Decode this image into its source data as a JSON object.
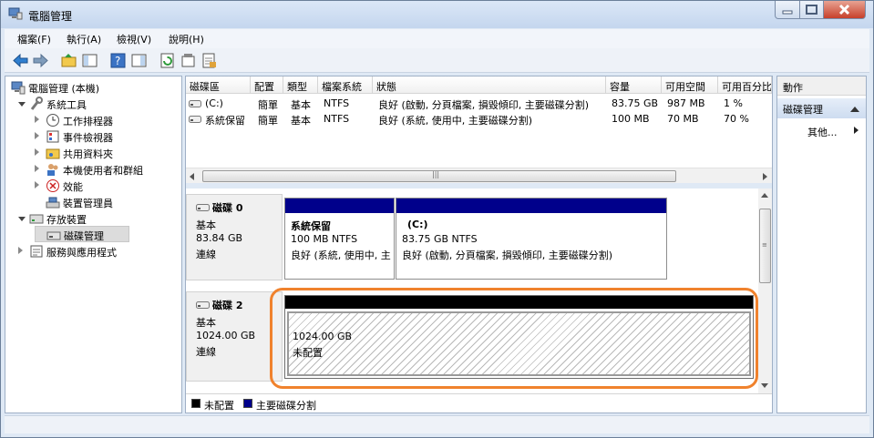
{
  "window": {
    "title": "電腦管理"
  },
  "menu": [
    "檔案(F)",
    "執行(A)",
    "檢視(V)",
    "說明(H)"
  ],
  "toolbar": {
    "icons": [
      "back-arrow-icon",
      "forward-arrow-icon",
      "up-folder-icon",
      "show-hide-tree-icon",
      "help-icon",
      "properties-view-icon",
      "refresh-icon",
      "properties-icon",
      "export-icon"
    ]
  },
  "tree": [
    {
      "label": "電腦管理 (本機)",
      "level": 0
    },
    {
      "label": "系統工具",
      "level": 1,
      "expanded": true
    },
    {
      "label": "工作排程器",
      "level": 2
    },
    {
      "label": "事件檢視器",
      "level": 2
    },
    {
      "label": "共用資料夾",
      "level": 2
    },
    {
      "label": "本機使用者和群組",
      "level": 2
    },
    {
      "label": "效能",
      "level": 2
    },
    {
      "label": "裝置管理員",
      "level": 2
    },
    {
      "label": "存放裝置",
      "level": 1,
      "expanded": true
    },
    {
      "label": "磁碟管理",
      "level": 2,
      "selected": true
    },
    {
      "label": "服務與應用程式",
      "level": 1
    }
  ],
  "volume_list": {
    "headers": [
      "磁碟區",
      "配置",
      "類型",
      "檔案系統",
      "狀態",
      "容量",
      "可用空間",
      "可用百分比"
    ],
    "rows": [
      [
        "(C:)",
        "簡單",
        "基本",
        "NTFS",
        "良好 (啟動, 分頁檔案, 損毀傾印, 主要磁碟分割)",
        "83.75 GB",
        "987 MB",
        "1 %"
      ],
      [
        "系統保留",
        "簡單",
        "基本",
        "NTFS",
        "良好 (系統, 使用中, 主要磁碟分割)",
        "100 MB",
        "70 MB",
        "70 %"
      ]
    ]
  },
  "disks": [
    {
      "name": "磁碟 0",
      "type": "基本",
      "size": "83.84 GB",
      "status": "連線",
      "partitions": [
        {
          "name": "系統保留",
          "size_fs": "100 MB NTFS",
          "status": "良好 (系統, 使用中, 主要磁碟分割)"
        },
        {
          "name": "(C:)",
          "size_fs": "83.75 GB NTFS",
          "status": "良好 (啟動, 分頁檔案, 損毀傾印, 主要磁碟分割)"
        }
      ]
    },
    {
      "name": "磁碟 2",
      "type": "基本",
      "size": "1024.00 GB",
      "status": "連線",
      "partitions": [
        {
          "size": "1024.00 GB",
          "status": "未配置"
        }
      ]
    }
  ],
  "legend": [
    {
      "label": "未配置",
      "color": "#000000"
    },
    {
      "label": "主要磁碟分割",
      "color": "#00008b"
    }
  ],
  "actions": {
    "title": "動作",
    "section": "磁碟管理",
    "more": "其他..."
  },
  "colors": {
    "primary_partition": "#00008b",
    "unallocated": "#000000",
    "highlight": "#f0822d"
  }
}
